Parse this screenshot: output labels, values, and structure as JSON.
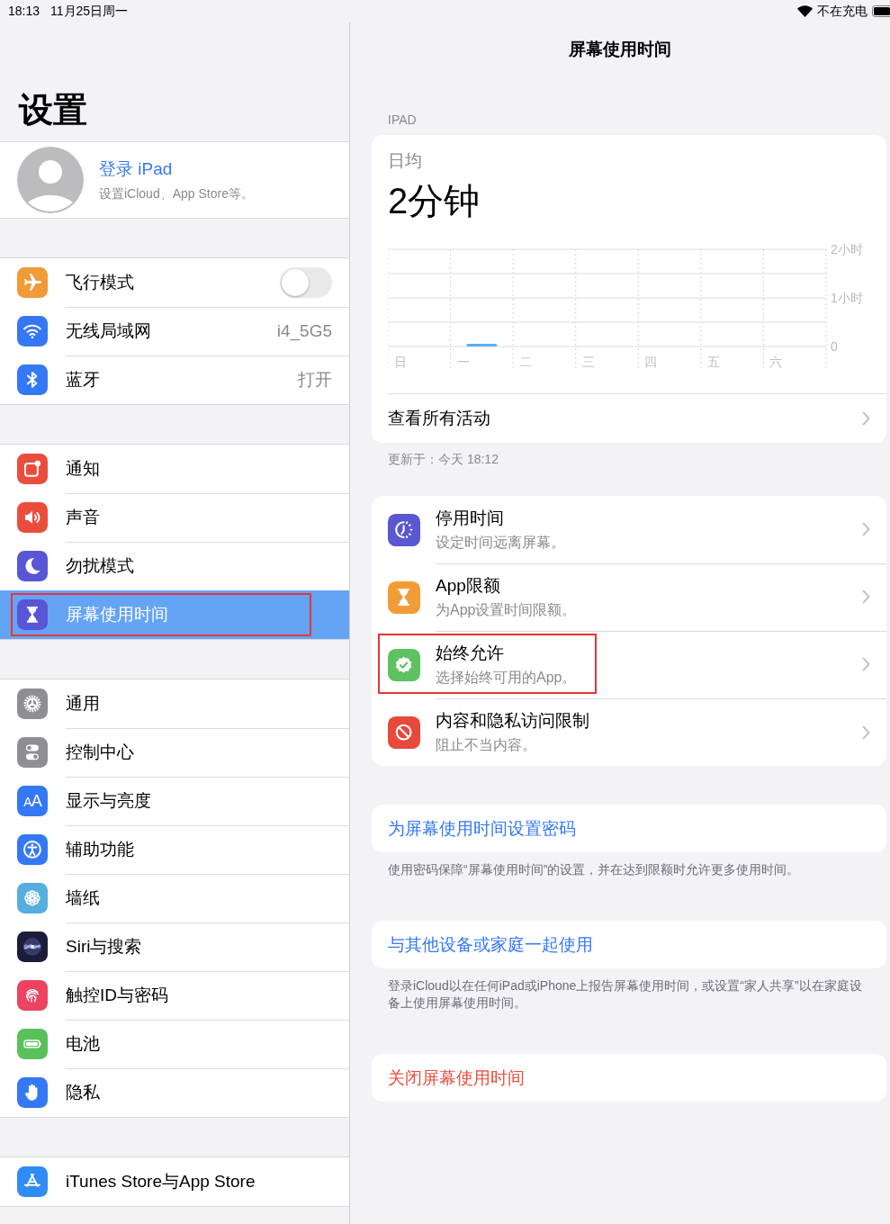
{
  "status_bar": {
    "time": "18:13",
    "date": "11月25日周一",
    "charging": "不在充电"
  },
  "sidebar": {
    "title": "设置",
    "account": {
      "name": "登录 iPad",
      "subtitle": "设置iCloud、App Store等。"
    },
    "groups": [
      {
        "items": [
          {
            "kind": "toggle",
            "label": "飞行模式",
            "on": false,
            "color": "#f19a38",
            "selected": false,
            "highlighted": false
          },
          {
            "kind": "value",
            "label": "无线局域网",
            "value": "i4_5G5",
            "color": "#3478f6",
            "selected": false,
            "highlighted": false
          },
          {
            "kind": "value",
            "label": "蓝牙",
            "value": "打开",
            "color": "#3478f6",
            "selected": false,
            "highlighted": false
          }
        ]
      },
      {
        "items": [
          {
            "kind": "plain",
            "label": "通知",
            "color": "#eb4d3d",
            "selected": false,
            "highlighted": false
          },
          {
            "kind": "plain",
            "label": "声音",
            "color": "#eb4d3d",
            "selected": false,
            "highlighted": false
          },
          {
            "kind": "plain",
            "label": "勿扰模式",
            "color": "#5856d6",
            "selected": false,
            "highlighted": false
          },
          {
            "kind": "plain",
            "label": "屏幕使用时间",
            "color": "#5856d6",
            "selected": true,
            "highlighted": true
          }
        ]
      },
      {
        "items": [
          {
            "kind": "plain",
            "label": "通用",
            "color": "#8e8e93",
            "selected": false,
            "highlighted": false
          },
          {
            "kind": "plain",
            "label": "控制中心",
            "color": "#8e8e93",
            "selected": false,
            "highlighted": false
          },
          {
            "kind": "plain",
            "label": "显示与亮度",
            "icon_text": "AA",
            "color": "#3478f6",
            "selected": false,
            "highlighted": false
          },
          {
            "kind": "plain",
            "label": "辅助功能",
            "color": "#3478f6",
            "selected": false,
            "highlighted": false
          },
          {
            "kind": "plain",
            "label": "墙纸",
            "color": "#55aee0",
            "selected": false,
            "highlighted": false
          },
          {
            "kind": "plain",
            "label": "Siri与搜索",
            "color": "#1c1c3a",
            "selected": false,
            "highlighted": false
          },
          {
            "kind": "plain",
            "label": "触控ID与密码",
            "color": "#eb4460",
            "selected": false,
            "highlighted": false
          },
          {
            "kind": "plain",
            "label": "电池",
            "color": "#5ac15a",
            "selected": false,
            "highlighted": false
          },
          {
            "kind": "plain",
            "label": "隐私",
            "color": "#3478f6",
            "selected": false,
            "highlighted": false
          }
        ]
      },
      {
        "items": [
          {
            "kind": "plain",
            "label": "iTunes Store与App Store",
            "color": "#2f8cf5",
            "selected": false,
            "highlighted": false
          }
        ]
      }
    ]
  },
  "detail": {
    "title": "屏幕使用时间",
    "section": "IPAD",
    "summary": {
      "caption": "日均",
      "value": "2分钟",
      "link": "查看所有活动",
      "chart_data": {
        "type": "bar",
        "categories": [
          "日",
          "一",
          "二",
          "三",
          "四",
          "五",
          "六"
        ],
        "series": [
          {
            "color": "#5ab0f5",
            "values": [
              0,
              0.03,
              0,
              0,
              0,
              0,
              0
            ]
          }
        ],
        "ylim": [
          0,
          2
        ],
        "yticks": [
          {
            "value": 0,
            "label": "0"
          },
          {
            "value": 1,
            "label": "1小时"
          },
          {
            "value": 2,
            "label": "2小时"
          }
        ]
      }
    },
    "updated": "更新于：今天 18:12",
    "features": [
      {
        "title": "停用时间",
        "subtitle": "设定时间远离屏幕。",
        "color": "#5a57d4",
        "highlighted": false
      },
      {
        "title": "App限额",
        "subtitle": "为App设置时间限额。",
        "color": "#f29c38",
        "highlighted": false
      },
      {
        "title": "始终允许",
        "subtitle": "选择始终可用的App。",
        "color": "#5ec162",
        "highlighted": true
      },
      {
        "title": "内容和隐私访问限制",
        "subtitle": "阻止不当内容。",
        "color": "#e8493d",
        "highlighted": false
      }
    ],
    "actions": [
      {
        "kind": "link",
        "label": "为屏幕使用时间设置密码",
        "footer": "使用密码保障“屏幕使用时间”的设置，并在达到限额时允许更多使用时间。"
      },
      {
        "kind": "link",
        "label": "与其他设备或家庭一起使用",
        "footer": "登录iCloud以在任何iPad或iPhone上报告屏幕使用时间，或设置“家人共享”以在家庭设备上使用屏幕使用时间。"
      },
      {
        "kind": "destructive",
        "label": "关闭屏幕使用时间"
      }
    ]
  }
}
